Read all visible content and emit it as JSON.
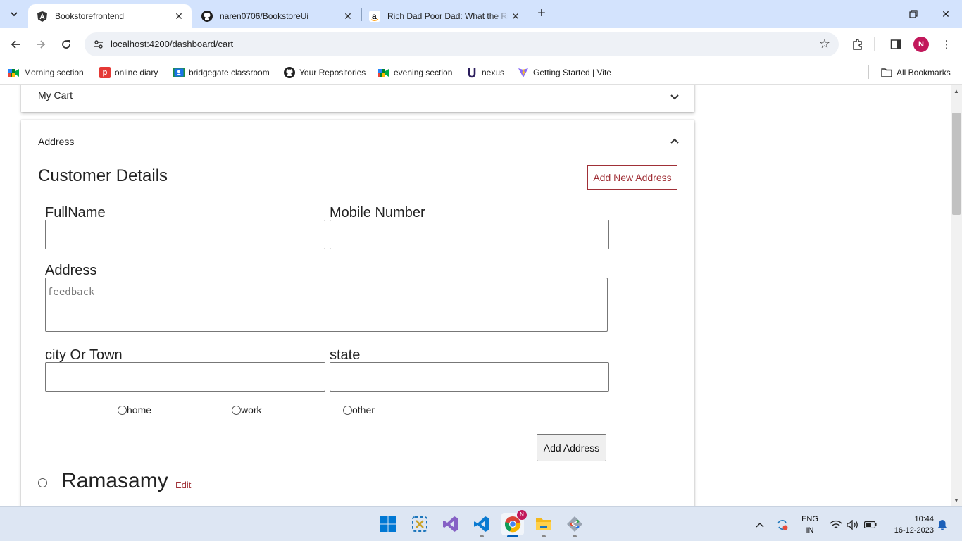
{
  "browser": {
    "tabs": [
      {
        "title": "Bookstorefrontend",
        "icon": "angular-icon",
        "active": true
      },
      {
        "title": "naren0706/BookstoreUi",
        "icon": "github-icon",
        "active": false
      },
      {
        "title": "Rich Dad Poor Dad: What the Ri",
        "icon": "amazon-icon",
        "active": false
      }
    ],
    "url": "localhost:4200/dashboard/cart",
    "profile_initial": "N",
    "bookmarks": [
      {
        "label": "Morning section",
        "icon": "google-meet-icon"
      },
      {
        "label": "online diary",
        "icon": "diary-icon"
      },
      {
        "label": "bridgegate classroom",
        "icon": "classroom-icon"
      },
      {
        "label": "Your Repositories",
        "icon": "github-icon"
      },
      {
        "label": "evening section",
        "icon": "google-meet-icon"
      },
      {
        "label": "nexus",
        "icon": "nexus-icon"
      },
      {
        "label": "Getting Started | Vite",
        "icon": "vite-icon"
      }
    ],
    "all_bookmarks": "All Bookmarks"
  },
  "page": {
    "cart_panel": {
      "title": "My Cart"
    },
    "address_panel": {
      "title": "Address",
      "heading": "Customer Details",
      "add_new_button": "Add New Address",
      "fields": {
        "fullname_label": "FullName",
        "mobile_label": "Mobile Number",
        "address_label": "Address",
        "address_placeholder": "feedback",
        "city_label": "city Or Town",
        "state_label": "state"
      },
      "address_types": [
        "home",
        "work",
        "other"
      ],
      "add_address_button": "Add Address",
      "saved": {
        "name": "Ramasamy",
        "edit_label": "Edit"
      }
    }
  },
  "taskbar": {
    "apps": [
      "windows-start-icon",
      "snipping-tool-icon",
      "visual-studio-icon",
      "vscode-icon",
      "chrome-icon",
      "file-explorer-icon",
      "git-extensions-icon"
    ],
    "chrome_badge": "N",
    "language": {
      "line1": "ENG",
      "line2": "IN"
    },
    "time": "10:44",
    "date": "16-12-2023"
  },
  "colors": {
    "accent": "#a03037",
    "tabstrip": "#d3e3fd",
    "taskbar": "#dde6f3"
  }
}
